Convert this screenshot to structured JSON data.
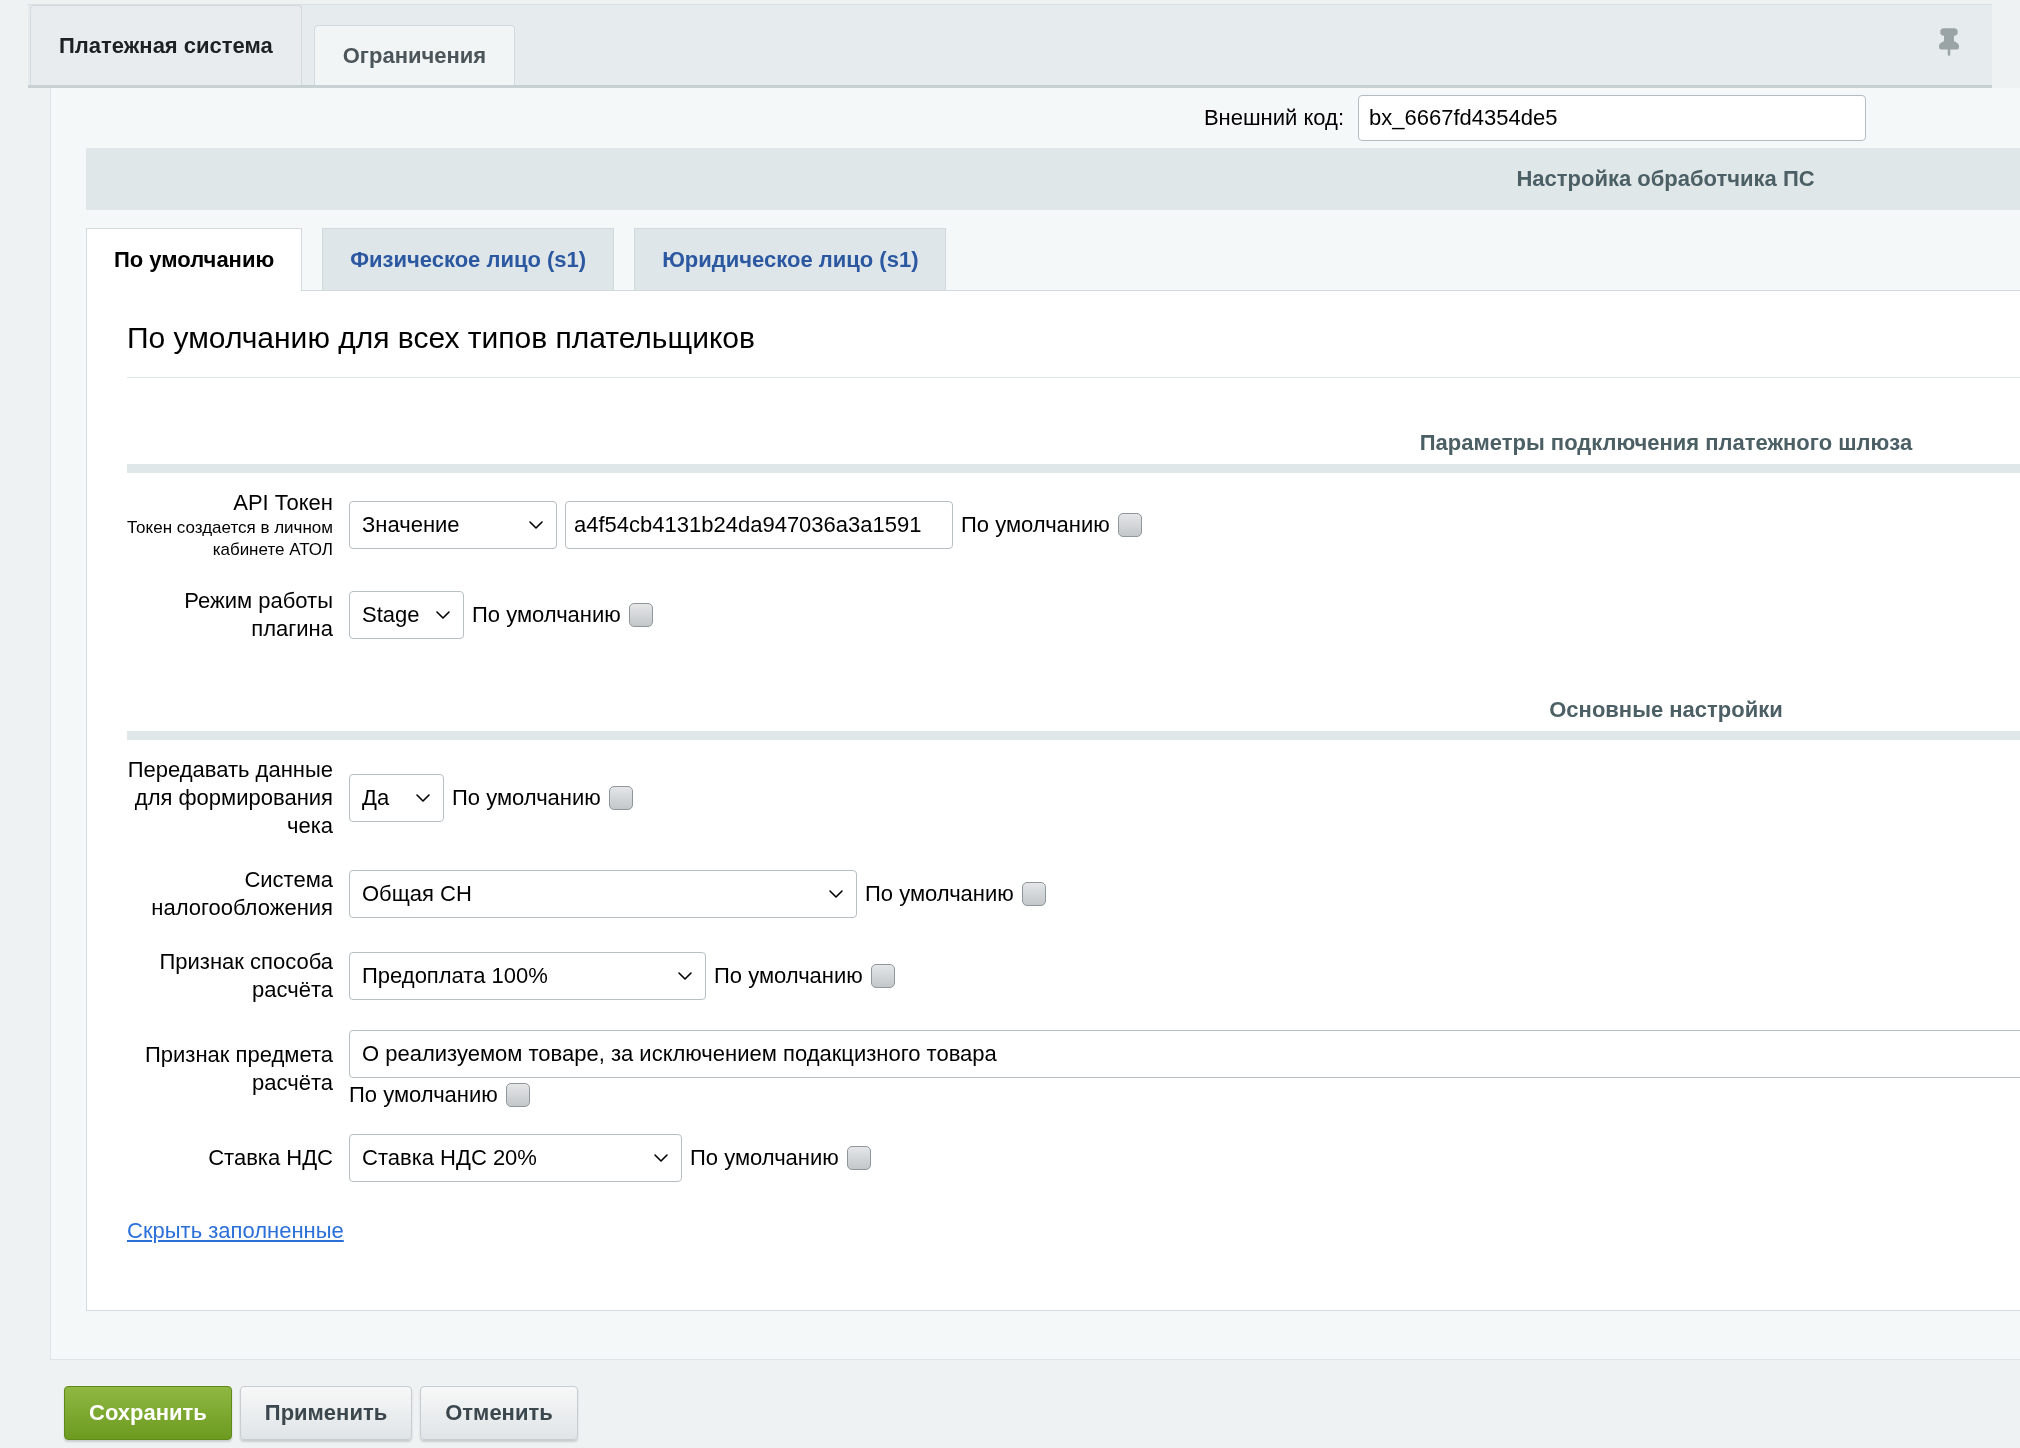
{
  "top_tabs": [
    {
      "label": "Платежная система",
      "selected": true
    },
    {
      "label": "Ограничения",
      "selected": false
    }
  ],
  "external_code": {
    "label": "Внешний код:",
    "value": "bx_6667fd4354de5"
  },
  "handler_header": "Настройка обработчика ПС",
  "payer_tabs": [
    {
      "label": "По умолчанию",
      "selected": true
    },
    {
      "label": "Физическое лицо (s1)",
      "selected": false
    },
    {
      "label": "Юридическое лицо (s1)",
      "selected": false
    }
  ],
  "heading": "По умолчанию для всех типов плательщиков",
  "sections": [
    {
      "title": "Параметры подключения платежного шлюза",
      "fields": [
        {
          "kind": "select_input",
          "label": "API Токен",
          "hint": "Токен создается в личном кабинете АТОЛ",
          "select": "Значение",
          "value": "a4f54cb4131b24da947036a3a1591",
          "default_label": "По умолчанию",
          "default_checked": false
        },
        {
          "kind": "select",
          "label": "Режим работы плагина",
          "select": "Stage",
          "default_label": "По умолчанию",
          "default_checked": false
        }
      ]
    },
    {
      "title": "Основные настройки",
      "fields": [
        {
          "kind": "select",
          "label": "Передавать данные для формирования чека",
          "select": "Да",
          "default_label": "По умолчанию",
          "default_checked": false
        },
        {
          "kind": "select",
          "label": "Система налогообложения",
          "select": "Общая СН",
          "default_label": "По умолчанию",
          "default_checked": false
        },
        {
          "kind": "select",
          "label": "Признак способа расчёта",
          "select": "Предоплата 100%",
          "default_label": "По умолчанию",
          "default_checked": false
        },
        {
          "kind": "wide_select",
          "label": "Признак предмета расчёта",
          "select": "О реализуемом товаре, за исключением подакцизного товара",
          "default_label": "По умолчанию",
          "default_checked": false
        },
        {
          "kind": "select",
          "label": "Ставка НДС",
          "select": "Ставка НДС 20%",
          "default_label": "По умолчанию",
          "default_checked": false
        }
      ]
    }
  ],
  "hide_link": "Скрыть заполненные",
  "buttons": [
    {
      "label": "Сохранить",
      "kind": "primary"
    },
    {
      "label": "Применить",
      "kind": "secondary"
    },
    {
      "label": "Отменить",
      "kind": "secondary"
    }
  ]
}
